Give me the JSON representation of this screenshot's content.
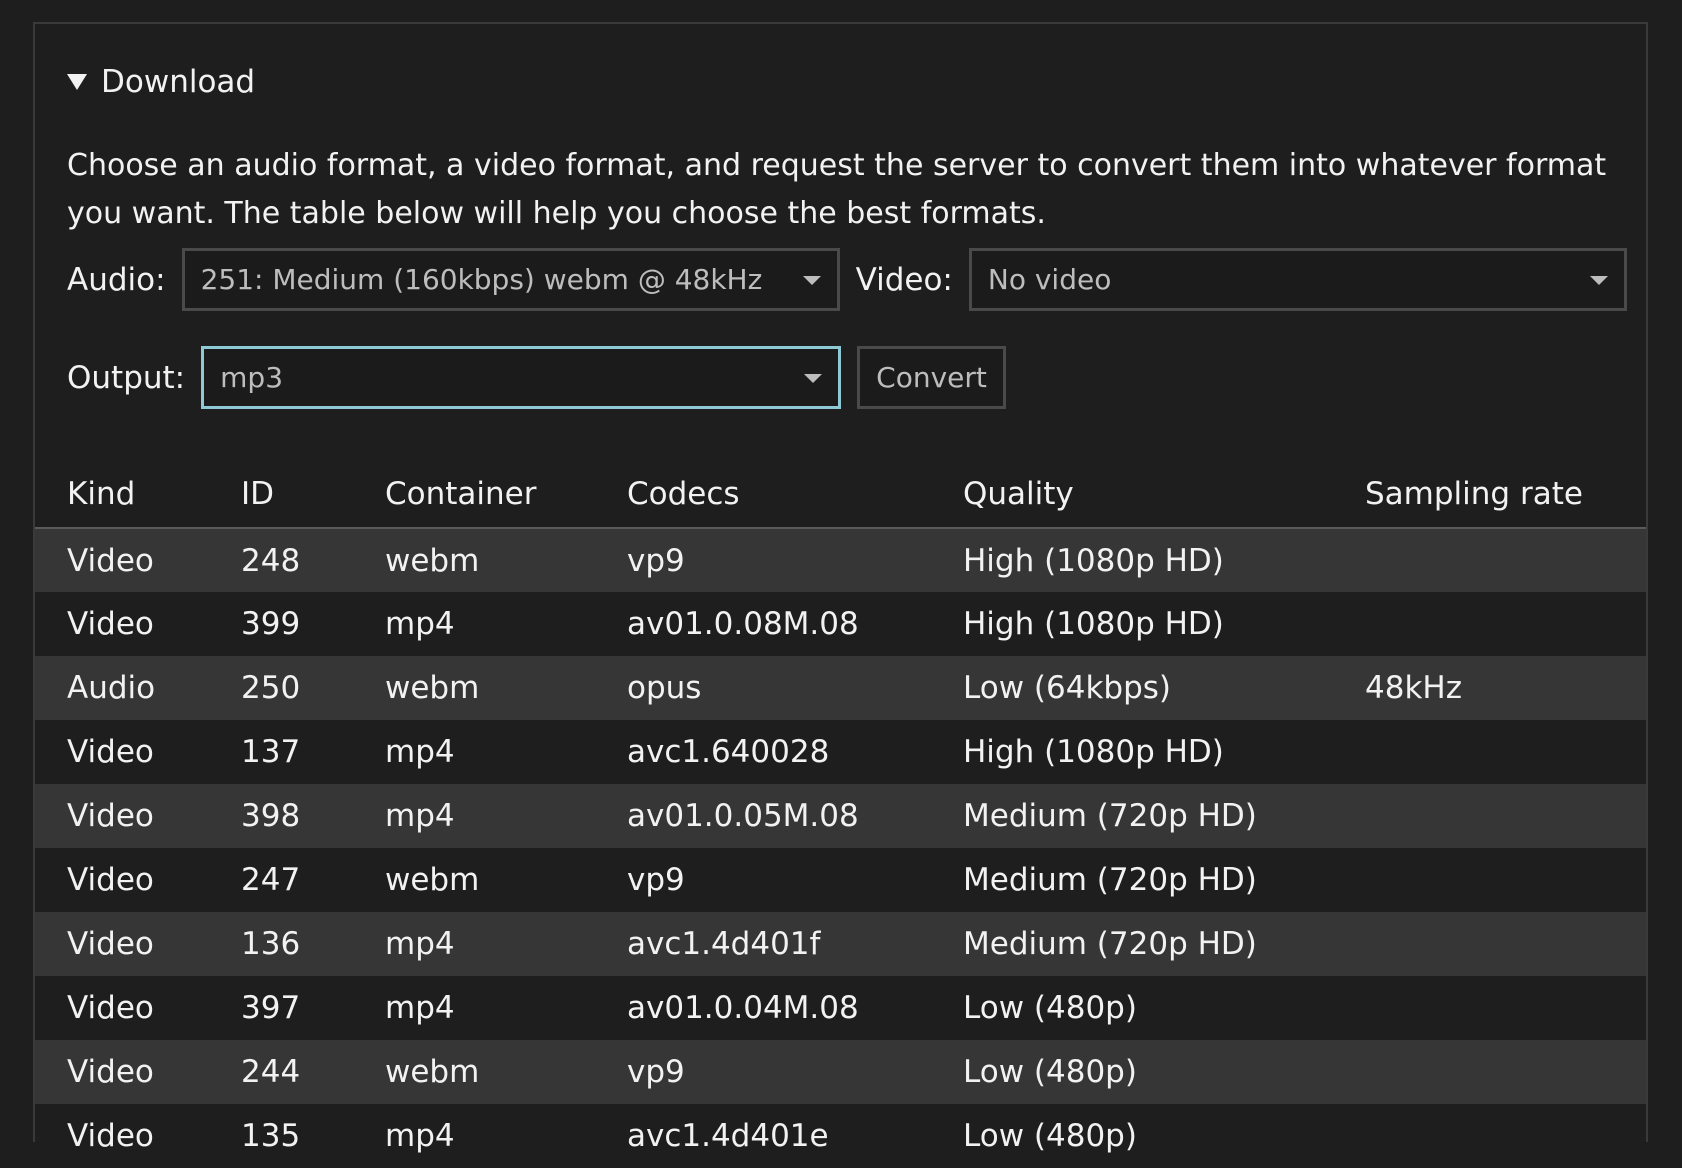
{
  "details": {
    "summary": "Download"
  },
  "description": "Choose an audio format, a video format, and request the server to convert them into whatever format you want. The table below will help you choose the best formats.",
  "controls": {
    "audio_label": "Audio:",
    "audio_value": "251: Medium (160kbps) webm @ 48kHz",
    "video_label": "Video:",
    "video_value": "No video",
    "output_label": "Output:",
    "output_value": "mp3",
    "convert_label": "Convert"
  },
  "table": {
    "headers": [
      "Kind",
      "ID",
      "Container",
      "Codecs",
      "Quality",
      "Sampling rate"
    ],
    "rows": [
      [
        "Video",
        "248",
        "webm",
        "vp9",
        "High (1080p HD)",
        ""
      ],
      [
        "Video",
        "399",
        "mp4",
        "av01.0.08M.08",
        "High (1080p HD)",
        ""
      ],
      [
        "Audio",
        "250",
        "webm",
        "opus",
        "Low (64kbps)",
        "48kHz"
      ],
      [
        "Video",
        "137",
        "mp4",
        "avc1.640028",
        "High (1080p HD)",
        ""
      ],
      [
        "Video",
        "398",
        "mp4",
        "av01.0.05M.08",
        "Medium (720p HD)",
        ""
      ],
      [
        "Video",
        "247",
        "webm",
        "vp9",
        "Medium (720p HD)",
        ""
      ],
      [
        "Video",
        "136",
        "mp4",
        "avc1.4d401f",
        "Medium (720p HD)",
        ""
      ],
      [
        "Video",
        "397",
        "mp4",
        "av01.0.04M.08",
        "Low (480p)",
        ""
      ],
      [
        "Video",
        "244",
        "webm",
        "vp9",
        "Low (480p)",
        ""
      ],
      [
        "Video",
        "135",
        "mp4",
        "avc1.4d401e",
        "Low (480p)",
        ""
      ]
    ]
  }
}
